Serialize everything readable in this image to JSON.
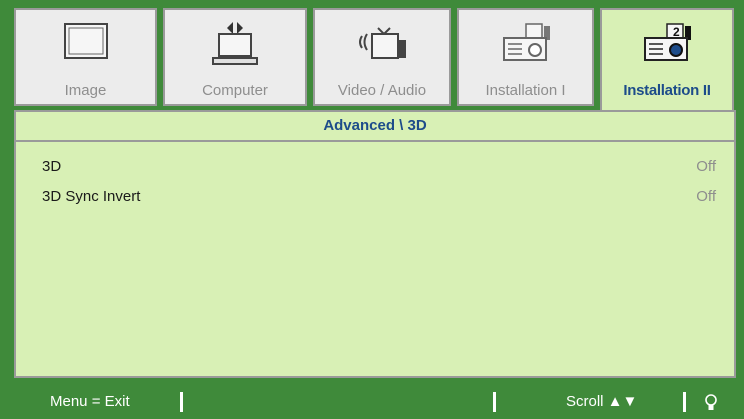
{
  "tabs": [
    {
      "label": "Image",
      "icon": "monitor-icon",
      "active": false
    },
    {
      "label": "Computer",
      "icon": "computer-icon",
      "active": false
    },
    {
      "label": "Video / Audio",
      "icon": "video-audio-icon",
      "active": false
    },
    {
      "label": "Installation I",
      "icon": "projector-icon",
      "active": false
    },
    {
      "label": "Installation II",
      "icon": "projector-advanced-icon",
      "active": true
    }
  ],
  "breadcrumb": "Advanced \\ 3D",
  "settings": [
    {
      "name": "3D",
      "value": "Off"
    },
    {
      "name": "3D Sync Invert",
      "value": "Off"
    }
  ],
  "status": {
    "menu_exit": "Menu = Exit",
    "scroll": "Scroll ▲▼",
    "icon": "lightbulb-icon"
  },
  "colors": {
    "frame_green": "#3f8a3a",
    "panel_green": "#d8f0b5",
    "active_text": "#1d4c8a",
    "inactive_text": "#8e8e8e"
  }
}
